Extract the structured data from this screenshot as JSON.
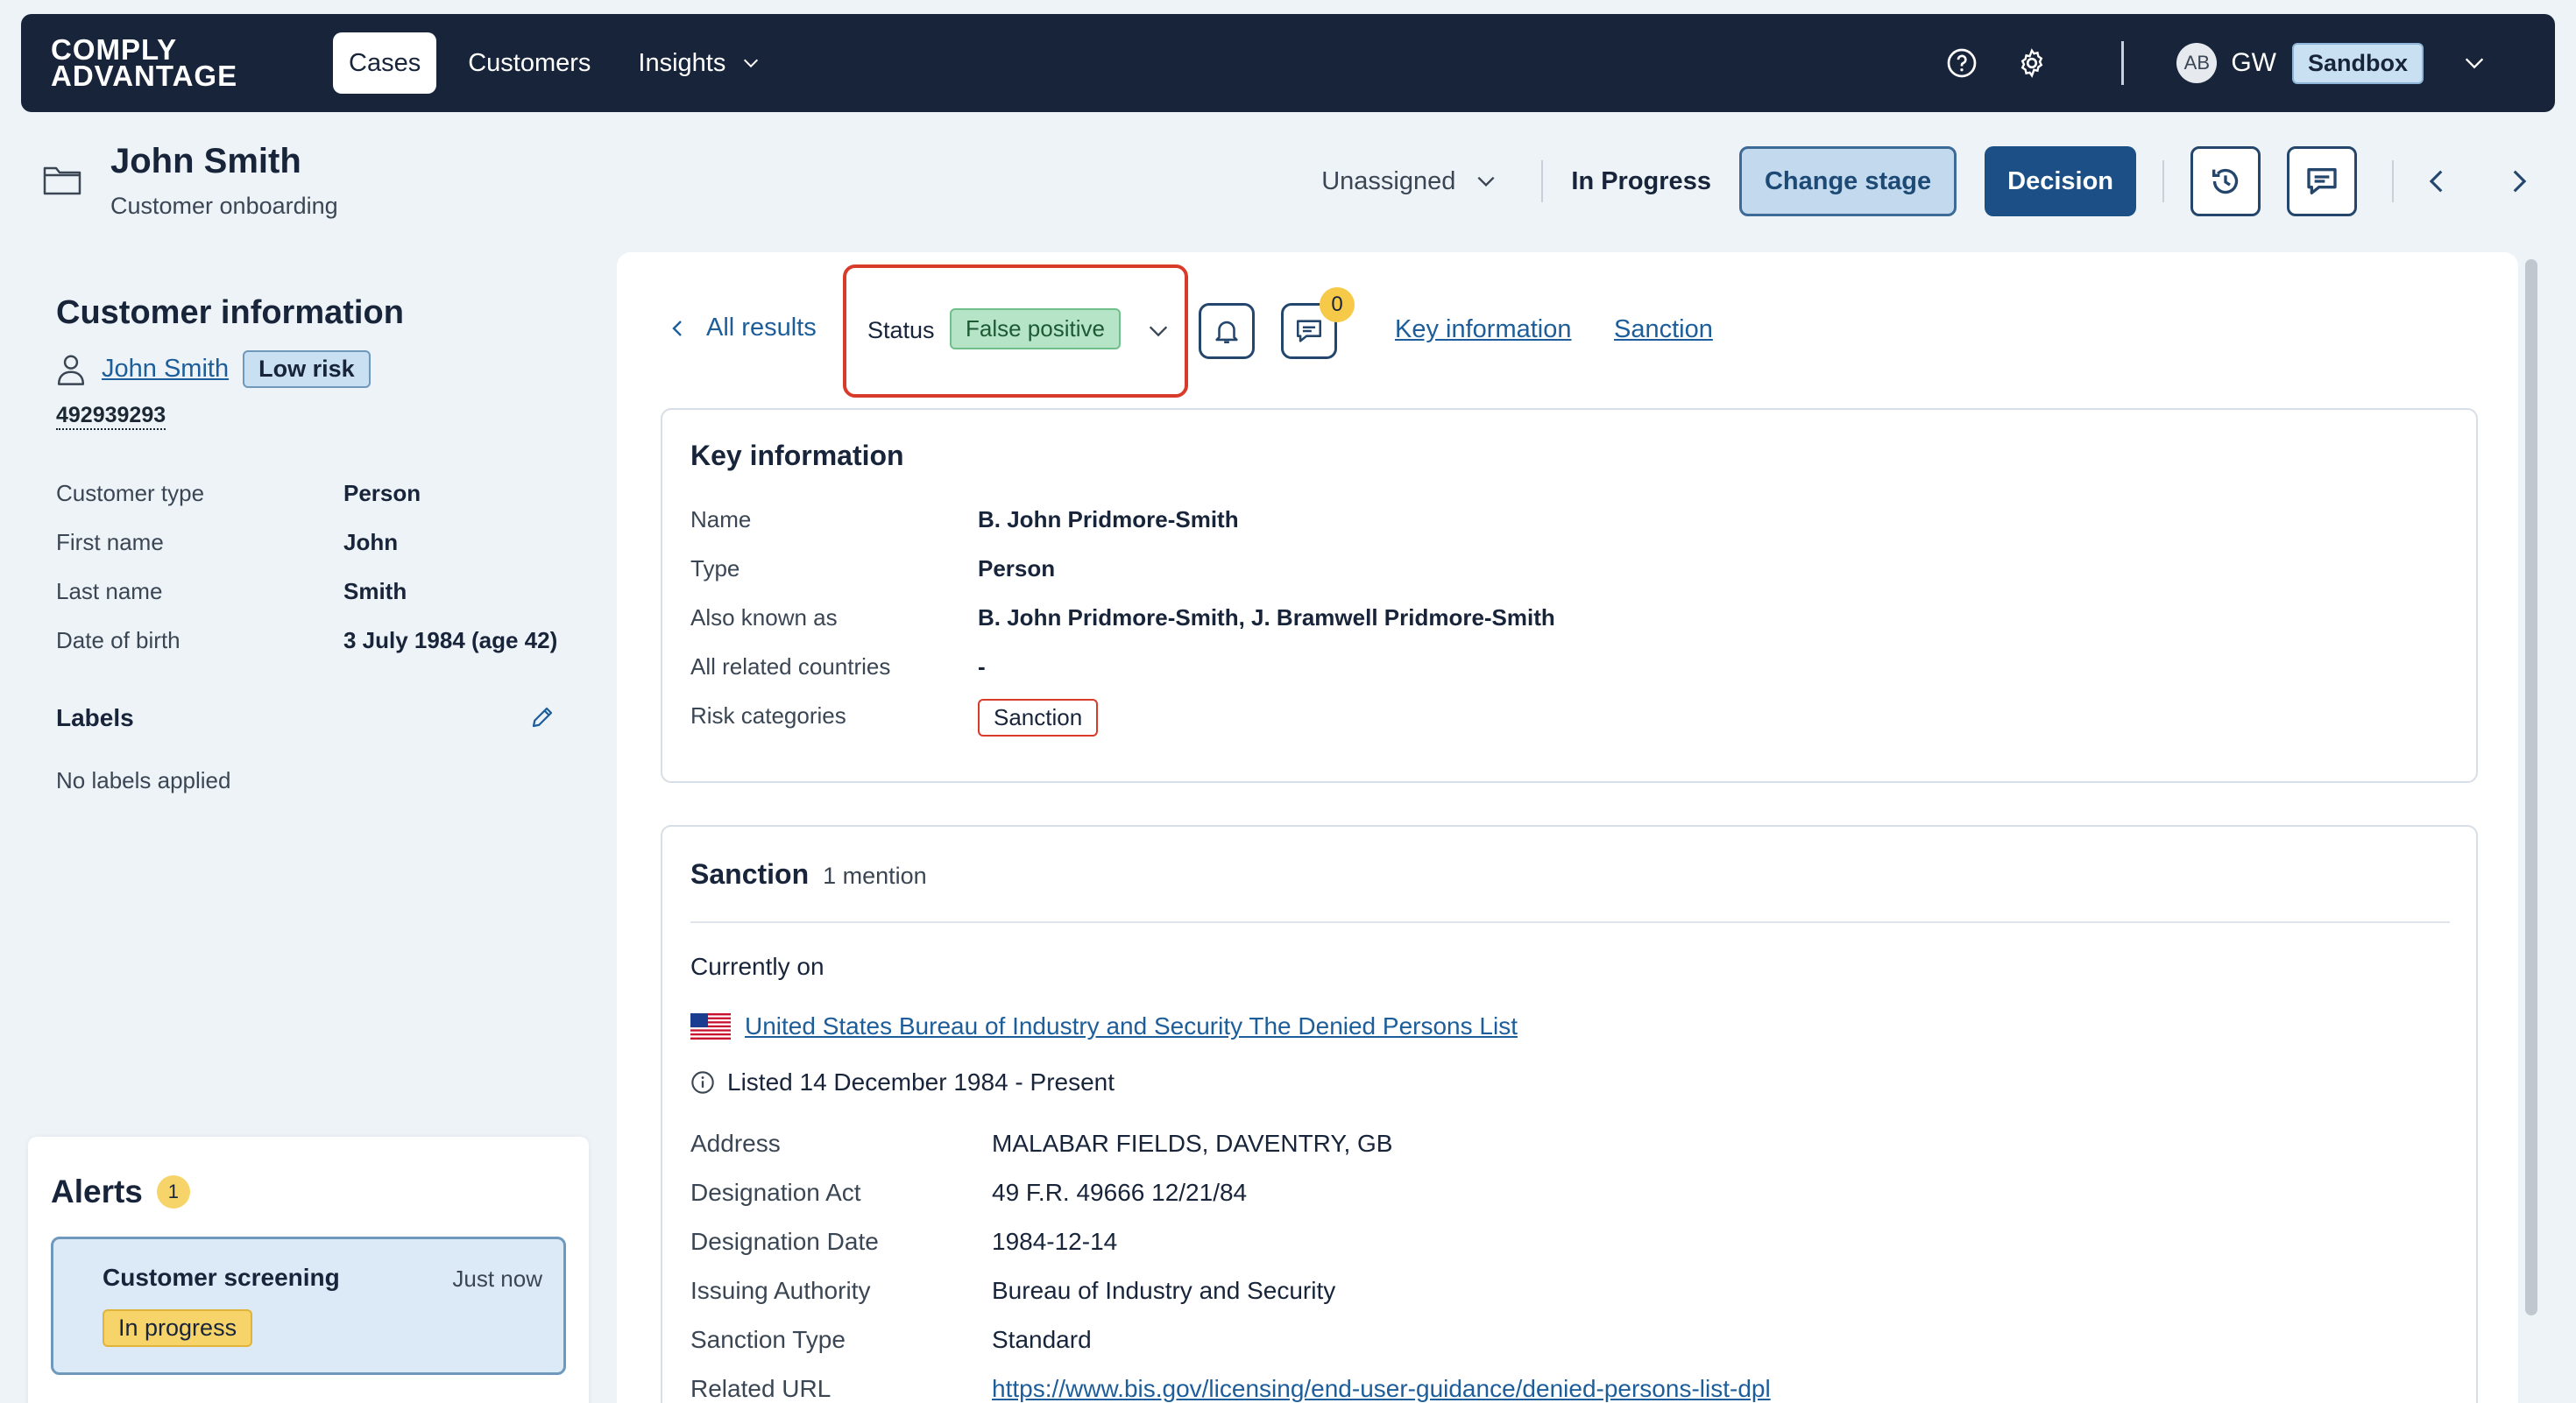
{
  "nav": {
    "logo_line1": "COMPLY",
    "logo_line2": "ADVANTAGE",
    "tabs": [
      {
        "label": "Cases"
      },
      {
        "label": "Customers"
      },
      {
        "label": "Insights"
      }
    ],
    "avatar": "AB",
    "user": "GW",
    "environment": "Sandbox"
  },
  "case": {
    "title": "John Smith",
    "subtitle": "Customer onboarding",
    "assignee": "Unassigned",
    "stage": "In Progress",
    "change_stage_label": "Change stage",
    "decision_label": "Decision"
  },
  "customer": {
    "section_title": "Customer information",
    "name": "John Smith",
    "risk": "Low risk",
    "id": "492939293",
    "fields": [
      {
        "label": "Customer type",
        "value": "Person"
      },
      {
        "label": "First name",
        "value": "John"
      },
      {
        "label": "Last name",
        "value": "Smith"
      },
      {
        "label": "Date of birth",
        "value": "3 July 1984 (age 42)"
      }
    ],
    "labels_title": "Labels",
    "labels_empty": "No labels applied"
  },
  "alerts": {
    "title": "Alerts",
    "count": "1",
    "items": [
      {
        "title": "Customer screening",
        "time": "Just now",
        "status": "In progress"
      }
    ]
  },
  "result": {
    "back_label": "All results",
    "status_label": "Status",
    "status_value": "False positive",
    "comment_count": "0",
    "anchors": [
      "Key information",
      "Sanction"
    ]
  },
  "key_info": {
    "title": "Key information",
    "fields": [
      {
        "label": "Name",
        "value": "B. John Pridmore-Smith"
      },
      {
        "label": "Type",
        "value": "Person"
      },
      {
        "label": "Also known as",
        "value": "B. John Pridmore-Smith, J. Bramwell Pridmore-Smith"
      },
      {
        "label": "All related countries",
        "value": "-"
      },
      {
        "label": "Risk categories",
        "value": "Sanction"
      }
    ]
  },
  "sanction": {
    "title": "Sanction",
    "mentions": "1 mention",
    "currently_on": "Currently on",
    "list_name": "United States Bureau of Industry and Security The Denied Persons List",
    "listed": "Listed 14 December 1984 - Present",
    "fields": [
      {
        "label": "Address",
        "value": "MALABAR FIELDS, DAVENTRY, GB"
      },
      {
        "label": "Designation Act",
        "value": "49 F.R. 49666 12/21/84"
      },
      {
        "label": "Designation Date",
        "value": "1984-12-14"
      },
      {
        "label": "Issuing Authority",
        "value": "Bureau of Industry and Security"
      },
      {
        "label": "Sanction Type",
        "value": "Standard"
      },
      {
        "label": "Related URL",
        "value": "https://www.bis.gov/licensing/end-user-guidance/denied-persons-list-dpl"
      }
    ]
  }
}
